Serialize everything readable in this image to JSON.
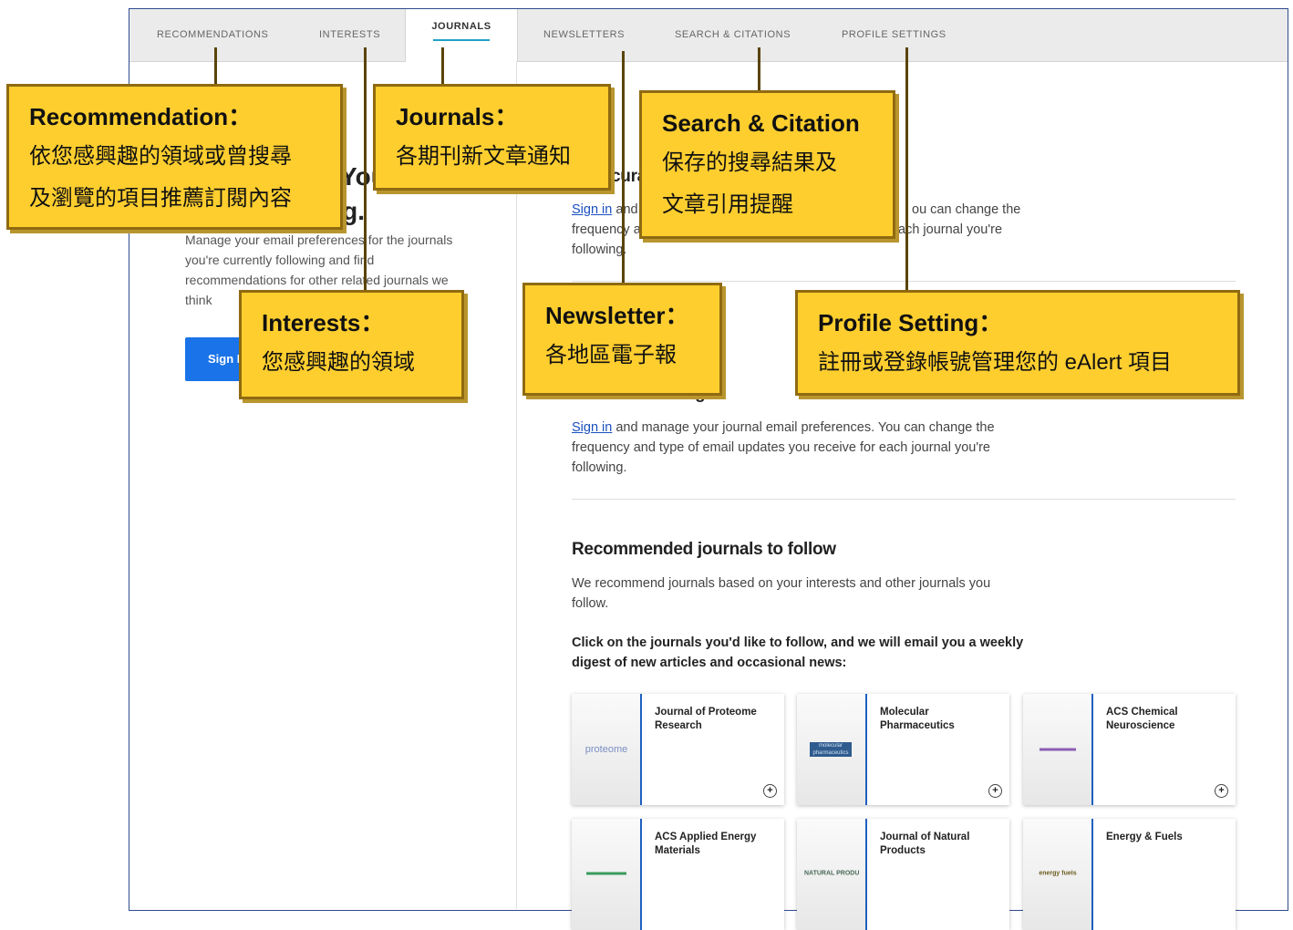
{
  "tabs": [
    "RECOMMENDATIONS",
    "INTERESTS",
    "JOURNALS",
    "NEWSLETTERS",
    "SEARCH & CITATIONS",
    "PROFILE SETTINGS"
  ],
  "sidebar": {
    "title_line1": "Your",
    "title_line2": "ng.",
    "description": "Manage your email preferences for the journals you're currently following and find recommendations for other related journals we think",
    "signin_button": "Sign I"
  },
  "main": {
    "section1": {
      "heading": "cura",
      "signin_link": "Sign in",
      "text_a": "and",
      "text_b": "ou can change the",
      "text_c": "frequency a",
      "text_d": "ach journal you're",
      "text_e": "following."
    },
    "section2": {
      "heading": "owing",
      "signin_link": "Sign in",
      "text": " and manage your journal email preferences. You can change the frequency and type of email updates you receive for each journal you're following."
    },
    "recommended": {
      "heading": "Recommended journals to follow",
      "text": "We recommend journals based on your interests and other journals you follow.",
      "instruction": "Click on the journals you'd like to follow, and we will email you a weekly digest of new articles and occasional news:"
    },
    "journals": [
      {
        "name": "Journal of Proteome Research",
        "logo": "proteome",
        "icon": "plus-circle-icon"
      },
      {
        "name": "Molecular Pharmaceutics",
        "logo": "molecular pharmaceutics",
        "icon": "plus-circle-icon"
      },
      {
        "name": "ACS Chemical Neuroscience",
        "logo": "",
        "icon": "plus-circle-icon"
      },
      {
        "name": "ACS Applied Energy Materials",
        "logo": "",
        "icon": "plus-circle-icon"
      },
      {
        "name": "Journal of Natural Products",
        "logo": "NATURAL PRODUCTS",
        "icon": "plus-circle-icon"
      },
      {
        "name": "Energy & Fuels",
        "logo": "energy fuels",
        "icon": "plus-circle-icon"
      }
    ]
  },
  "callouts": {
    "recommendation": {
      "title": "Recommendation：",
      "line1": "依您感興趣的領域或曾搜尋",
      "line2": "及瀏覽的項目推薦訂閱內容"
    },
    "journals": {
      "title": "Journals：",
      "line1": "各期刊新文章通知"
    },
    "search": {
      "title": "Search & Citation",
      "line1": "保存的搜尋結果及",
      "line2": "文章引用提醒"
    },
    "interests": {
      "title": "Interests：",
      "line1": "您感興趣的領域"
    },
    "newsletter": {
      "title": "Newsletter：",
      "line1": "各地區電子報"
    },
    "profile": {
      "title": "Profile Setting：",
      "line1": "註冊或登錄帳號管理您的 eAlert 項目"
    }
  },
  "colors": {
    "callout_fill": "#fece2f",
    "callout_border": "#8f6a10",
    "tab_accent": "#1ea1c8",
    "button_blue": "#1a73e8"
  }
}
